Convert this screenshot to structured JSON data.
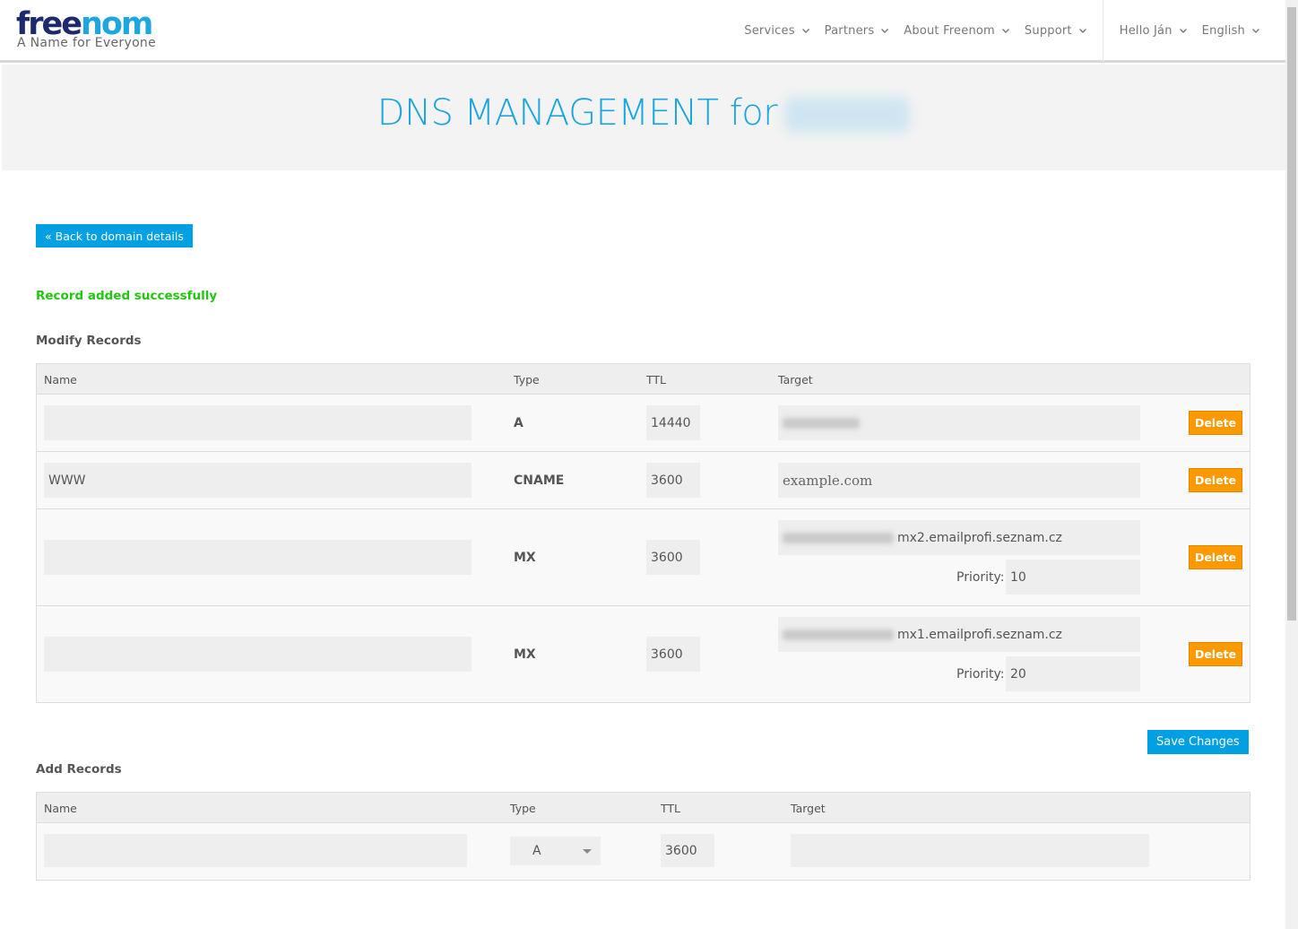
{
  "brand": {
    "logo_part1": "free",
    "logo_part2": "nom",
    "tagline": "A Name for Everyone"
  },
  "nav": {
    "items": [
      "Services",
      "Partners",
      "About Freenom",
      "Support"
    ],
    "user": "Hello Ján",
    "language": "English"
  },
  "banner": {
    "title": "DNS MANAGEMENT for"
  },
  "back_button": "« Back to domain details",
  "status_message": "Record added successfully",
  "modify": {
    "title": "Modify Records",
    "headers": {
      "name": "Name",
      "type": "Type",
      "ttl": "TTL",
      "target": "Target"
    },
    "priority_label": "Priority:",
    "delete_label": "Delete",
    "records": [
      {
        "name": "",
        "type": "A",
        "ttl": "14440",
        "target": ""
      },
      {
        "name": "WWW",
        "type": "CNAME",
        "ttl": "3600",
        "target": "example.com"
      },
      {
        "name": "",
        "type": "MX",
        "ttl": "3600",
        "target": "mx2.emailprofi.seznam.cz",
        "priority": "10"
      },
      {
        "name": "",
        "type": "MX",
        "ttl": "3600",
        "target": "mx1.emailprofi.seznam.cz",
        "priority": "20"
      }
    ]
  },
  "save_button": "Save Changes",
  "add": {
    "title": "Add Records",
    "headers": {
      "name": "Name",
      "type": "Type",
      "ttl": "TTL",
      "target": "Target"
    },
    "row": {
      "name": "",
      "type": "A",
      "ttl": "3600",
      "target": ""
    }
  },
  "colors": {
    "accent": "#00a0e3",
    "delete": "#ff9900",
    "success": "#22c510",
    "logo_dark": "#1d2a6e",
    "logo_light": "#1da6e0"
  }
}
